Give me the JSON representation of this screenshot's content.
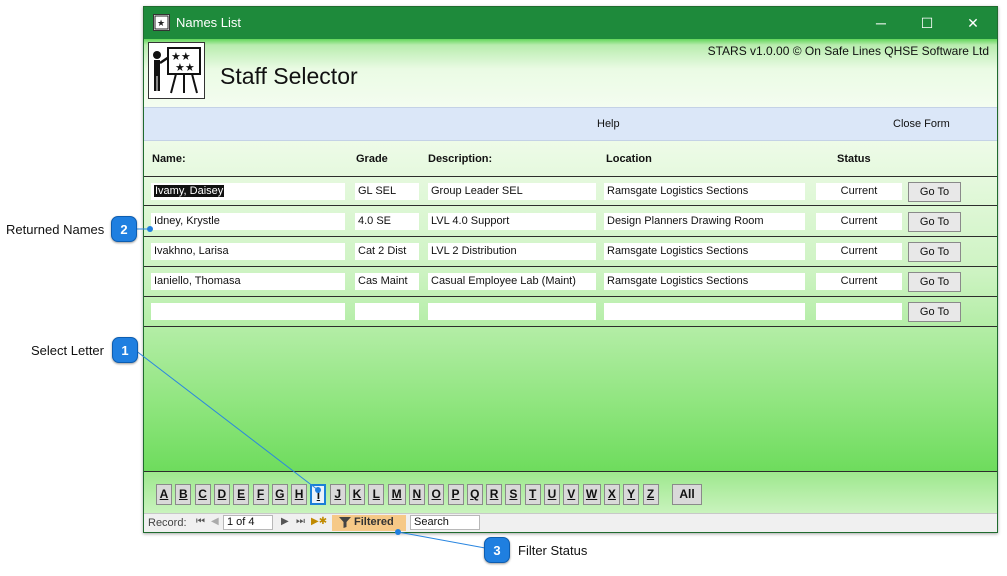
{
  "window": {
    "title": "Names List",
    "minimize_glyph": "─",
    "maximize_glyph": "☐",
    "close_glyph": "✕"
  },
  "header": {
    "form_title": "Staff Selector",
    "copyright": "STARS v1.0.00 © On Safe Lines QHSE Software Ltd"
  },
  "command_bar": {
    "help": "Help",
    "close_form": "Close Form"
  },
  "columns": {
    "name": "Name:",
    "grade": "Grade",
    "description": "Description:",
    "location": "Location",
    "status": "Status"
  },
  "rows": [
    {
      "name": "Ivamy, Daisey",
      "grade": "GL SEL",
      "description": "Group Leader SEL",
      "location": "Ramsgate Logistics Sections",
      "status": "Current",
      "go": "Go To"
    },
    {
      "name": "Idney, Krystle",
      "grade": "4.0 SE",
      "description": "LVL 4.0 Support",
      "location": "Design Planners Drawing Room",
      "status": "Current",
      "go": "Go To"
    },
    {
      "name": "Ivakhno, Larisa",
      "grade": "Cat 2 Dist",
      "description": "LVL 2 Distribution",
      "location": "Ramsgate Logistics Sections",
      "status": "Current",
      "go": "Go To"
    },
    {
      "name": "Ianiello, Thomasa",
      "grade": "Cas Maint",
      "description": "Casual Employee Lab (Maint)",
      "location": "Ramsgate Logistics Sections",
      "status": "Current",
      "go": "Go To"
    },
    {
      "name": "",
      "grade": "",
      "description": "",
      "location": "",
      "status": "",
      "go": "Go To"
    }
  ],
  "letters": [
    "A",
    "B",
    "C",
    "D",
    "E",
    "F",
    "G",
    "H",
    "I",
    "J",
    "K",
    "L",
    "M",
    "N",
    "O",
    "P",
    "Q",
    "R",
    "S",
    "T",
    "U",
    "V",
    "W",
    "X",
    "Y",
    "Z"
  ],
  "active_letter": "I",
  "all_button": "All",
  "record_nav": {
    "label": "Record:",
    "first": "⏮",
    "prev": "◀",
    "position": "1 of 4",
    "next": "▶",
    "last": "⏭",
    "new": "▶✱",
    "filter": "Filtered",
    "search": "Search"
  },
  "callouts": [
    {
      "number": "1",
      "text": "Select Letter"
    },
    {
      "number": "2",
      "text": "Returned Names"
    },
    {
      "number": "3",
      "text": "Filter Status"
    }
  ],
  "colors": {
    "titlebar": "#1e8a3b",
    "accent_green": "#6edc5d",
    "callout_blue": "#1f7fe0",
    "filter_orange": "#f6c987"
  }
}
